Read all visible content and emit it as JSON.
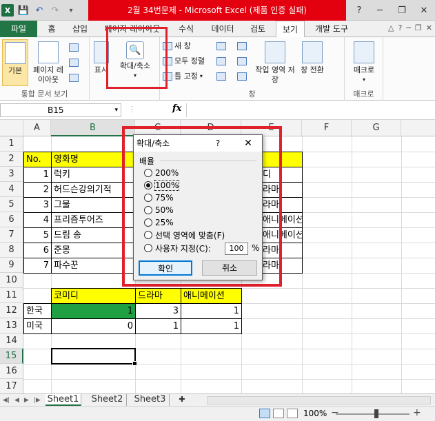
{
  "window": {
    "title": "2월 34번문제 - Microsoft Excel (제품 인증 실패)",
    "help": "?",
    "minimize": "─",
    "restore": "❐",
    "close": "✕"
  },
  "tabs": [
    "파일",
    "홈",
    "삽입",
    "페이지 레이아웃",
    "수식",
    "데이터",
    "검토",
    "보기",
    "개발 도구"
  ],
  "ribbon": {
    "group_views": {
      "label": "통합 문서 보기",
      "normal": "기본",
      "page_layout": "페이지 레이아웃",
      "show": "표시"
    },
    "group_zoom": {
      "zoom": "확대/축소"
    },
    "group_window": {
      "label": "창",
      "new_window": "새 창",
      "arrange_all": "모두 정렬",
      "freeze": "틀 고정",
      "save_workspace": "작업 영역 저장",
      "switch": "창 전환"
    },
    "group_macro": {
      "label": "매크로",
      "macros": "매크로"
    }
  },
  "formula_bar": {
    "name_box": "B15",
    "fx": "fx",
    "formula": ""
  },
  "columns": [
    "A",
    "B",
    "C",
    "D",
    "E",
    "F",
    "G"
  ],
  "rows": [
    "1",
    "2",
    "3",
    "4",
    "5",
    "6",
    "7",
    "8",
    "9",
    "10",
    "11",
    "12",
    "13",
    "14",
    "15",
    "16",
    "17"
  ],
  "table1": {
    "header_no": "No.",
    "header_title": "영화명",
    "e_header": "",
    "rows": [
      {
        "no": "1",
        "title": "럭키",
        "genre": "디"
      },
      {
        "no": "2",
        "title": "허드슨강의기적",
        "genre": "라마"
      },
      {
        "no": "3",
        "title": "그물",
        "genre": "라마"
      },
      {
        "no": "4",
        "title": "프리즘투어즈",
        "genre": "애니메이션"
      },
      {
        "no": "5",
        "title": "드림 송",
        "genre": "애니메이션"
      },
      {
        "no": "6",
        "title": "준몽",
        "genre": "라마"
      },
      {
        "no": "7",
        "title": "파수꾼",
        "genre": "라마"
      }
    ]
  },
  "table2": {
    "headers": [
      "코미디",
      "드라마",
      "애니메이션"
    ],
    "rows": [
      {
        "label": "한국",
        "values": [
          "1",
          "3",
          "1"
        ]
      },
      {
        "label": "미국",
        "values": [
          "0",
          "1",
          "1"
        ]
      }
    ]
  },
  "dialog": {
    "title": "확대/축소",
    "help": "?",
    "close": "✕",
    "section": "배율",
    "options": [
      "200%",
      "100%",
      "75%",
      "50%",
      "25%",
      "선택 영역에 맞춤(F)",
      "사용자 지정(C):"
    ],
    "selected_index": 1,
    "custom_value": "100",
    "percent": "%",
    "ok": "확인",
    "cancel": "취소"
  },
  "sheets": [
    "Sheet1",
    "Sheet2",
    "Sheet3"
  ],
  "statusbar": {
    "zoom": "100%",
    "minus": "−",
    "plus": "+"
  },
  "colors": {
    "accent_green": "#217346",
    "highlight_red": "#e0202a",
    "yellow": "#ffff00",
    "cell_green": "#1fa043"
  }
}
